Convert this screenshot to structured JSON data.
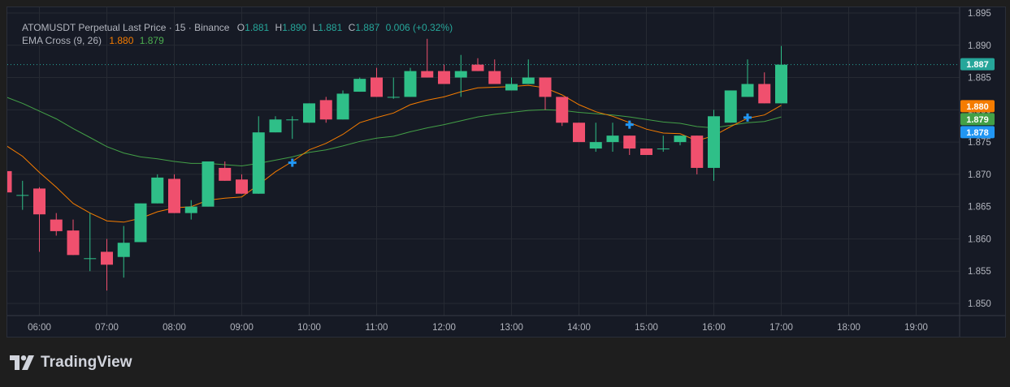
{
  "legend": {
    "symbol_line": "ATOMUSDT Perpetual Last Price · 15 · Binance",
    "o_label": "O",
    "o_value": "1.881",
    "h_label": "H",
    "h_value": "1.890",
    "l_label": "L",
    "l_value": "1.881",
    "c_label": "C",
    "c_value": "1.887",
    "change": "0.006 (+0.32%)",
    "ema_label": "EMA Cross (9, 26)",
    "ema_fast_value": "1.880",
    "ema_slow_value": "1.879"
  },
  "brand": {
    "name": "TradingView"
  },
  "colors": {
    "up": "#26a69a",
    "down": "#ef5350",
    "up_body": "#2fbf88",
    "down_body": "#f0506e",
    "ema_fast": "#f57c00",
    "ema_slow": "#43a047",
    "cross_marker": "#2196f3",
    "tag_last": "#26a69a",
    "tag_fast": "#f57c00",
    "tag_slow": "#43a047",
    "tag_cross": "#2196f3"
  },
  "chart_data": {
    "type": "candlestick",
    "timeframe": "15",
    "y_ticks": [
      "1.895",
      "1.890",
      "1.885",
      "1.880",
      "1.875",
      "1.870",
      "1.865",
      "1.860",
      "1.855",
      "1.850"
    ],
    "ylim": [
      1.8483,
      1.8968
    ],
    "x_ticks": [
      "06:00",
      "07:00",
      "08:00",
      "09:00",
      "10:00",
      "11:00",
      "12:00",
      "13:00",
      "14:00",
      "15:00",
      "16:00",
      "17:00",
      "18:00",
      "19:00"
    ],
    "x_tick_hours": [
      6,
      7,
      8,
      9,
      10,
      11,
      12,
      13,
      14,
      15,
      16,
      17,
      18,
      19
    ],
    "candles": [
      {
        "t": 5.5,
        "o": 1.8705,
        "h": 1.8719,
        "l": 1.8672,
        "c": 1.8672
      },
      {
        "t": 5.75,
        "o": 1.8668,
        "h": 1.869,
        "l": 1.8645,
        "c": 1.8668
      },
      {
        "t": 6.0,
        "o": 1.8678,
        "h": 1.868,
        "l": 1.858,
        "c": 1.8638
      },
      {
        "t": 6.25,
        "o": 1.863,
        "h": 1.864,
        "l": 1.8605,
        "c": 1.8612
      },
      {
        "t": 6.5,
        "o": 1.8613,
        "h": 1.863,
        "l": 1.8575,
        "c": 1.8575
      },
      {
        "t": 6.75,
        "o": 1.857,
        "h": 1.864,
        "l": 1.855,
        "c": 1.857
      },
      {
        "t": 7.0,
        "o": 1.858,
        "h": 1.86,
        "l": 1.852,
        "c": 1.856
      },
      {
        "t": 7.25,
        "o": 1.8572,
        "h": 1.862,
        "l": 1.854,
        "c": 1.8594
      },
      {
        "t": 7.5,
        "o": 1.8595,
        "h": 1.8655,
        "l": 1.8595,
        "c": 1.8655
      },
      {
        "t": 7.75,
        "o": 1.8655,
        "h": 1.87,
        "l": 1.8655,
        "c": 1.8695
      },
      {
        "t": 8.0,
        "o": 1.8693,
        "h": 1.87,
        "l": 1.864,
        "c": 1.864
      },
      {
        "t": 8.25,
        "o": 1.864,
        "h": 1.866,
        "l": 1.863,
        "c": 1.865
      },
      {
        "t": 8.5,
        "o": 1.865,
        "h": 1.872,
        "l": 1.865,
        "c": 1.872
      },
      {
        "t": 8.75,
        "o": 1.871,
        "h": 1.872,
        "l": 1.869,
        "c": 1.869
      },
      {
        "t": 9.0,
        "o": 1.8692,
        "h": 1.87,
        "l": 1.867,
        "c": 1.867
      },
      {
        "t": 9.25,
        "o": 1.867,
        "h": 1.879,
        "l": 1.867,
        "c": 1.8765
      },
      {
        "t": 9.5,
        "o": 1.8765,
        "h": 1.879,
        "l": 1.8765,
        "c": 1.8785
      },
      {
        "t": 9.75,
        "o": 1.8785,
        "h": 1.879,
        "l": 1.8755,
        "c": 1.8785
      },
      {
        "t": 10.0,
        "o": 1.878,
        "h": 1.881,
        "l": 1.878,
        "c": 1.881
      },
      {
        "t": 10.25,
        "o": 1.8815,
        "h": 1.882,
        "l": 1.878,
        "c": 1.8785
      },
      {
        "t": 10.5,
        "o": 1.8785,
        "h": 1.883,
        "l": 1.8785,
        "c": 1.8825
      },
      {
        "t": 10.75,
        "o": 1.8828,
        "h": 1.885,
        "l": 1.8828,
        "c": 1.8848
      },
      {
        "t": 11.0,
        "o": 1.885,
        "h": 1.8865,
        "l": 1.882,
        "c": 1.882
      },
      {
        "t": 11.25,
        "o": 1.882,
        "h": 1.885,
        "l": 1.8817,
        "c": 1.882
      },
      {
        "t": 11.5,
        "o": 1.882,
        "h": 1.8865,
        "l": 1.882,
        "c": 1.886
      },
      {
        "t": 11.75,
        "o": 1.886,
        "h": 1.891,
        "l": 1.885,
        "c": 1.885
      },
      {
        "t": 12.0,
        "o": 1.886,
        "h": 1.887,
        "l": 1.884,
        "c": 1.884
      },
      {
        "t": 12.25,
        "o": 1.885,
        "h": 1.8885,
        "l": 1.882,
        "c": 1.886
      },
      {
        "t": 12.5,
        "o": 1.887,
        "h": 1.888,
        "l": 1.886,
        "c": 1.886
      },
      {
        "t": 12.75,
        "o": 1.886,
        "h": 1.8878,
        "l": 1.884,
        "c": 1.884
      },
      {
        "t": 13.0,
        "o": 1.883,
        "h": 1.885,
        "l": 1.883,
        "c": 1.884
      },
      {
        "t": 13.25,
        "o": 1.884,
        "h": 1.8878,
        "l": 1.884,
        "c": 1.885
      },
      {
        "t": 13.5,
        "o": 1.885,
        "h": 1.885,
        "l": 1.88,
        "c": 1.882
      },
      {
        "t": 13.75,
        "o": 1.882,
        "h": 1.882,
        "l": 1.8775,
        "c": 1.878
      },
      {
        "t": 14.0,
        "o": 1.878,
        "h": 1.878,
        "l": 1.875,
        "c": 1.875
      },
      {
        "t": 14.25,
        "o": 1.874,
        "h": 1.878,
        "l": 1.8735,
        "c": 1.875
      },
      {
        "t": 14.5,
        "o": 1.875,
        "h": 1.878,
        "l": 1.8735,
        "c": 1.876
      },
      {
        "t": 14.75,
        "o": 1.876,
        "h": 1.876,
        "l": 1.873,
        "c": 1.874
      },
      {
        "t": 15.0,
        "o": 1.874,
        "h": 1.874,
        "l": 1.873,
        "c": 1.873
      },
      {
        "t": 15.25,
        "o": 1.874,
        "h": 1.876,
        "l": 1.8735,
        "c": 1.874
      },
      {
        "t": 15.5,
        "o": 1.875,
        "h": 1.876,
        "l": 1.8745,
        "c": 1.876
      },
      {
        "t": 15.75,
        "o": 1.876,
        "h": 1.876,
        "l": 1.87,
        "c": 1.871
      },
      {
        "t": 16.0,
        "o": 1.871,
        "h": 1.88,
        "l": 1.869,
        "c": 1.879
      },
      {
        "t": 16.25,
        "o": 1.878,
        "h": 1.883,
        "l": 1.878,
        "c": 1.883
      },
      {
        "t": 16.5,
        "o": 1.882,
        "h": 1.8878,
        "l": 1.882,
        "c": 1.884
      },
      {
        "t": 16.75,
        "o": 1.884,
        "h": 1.8858,
        "l": 1.881,
        "c": 1.881
      },
      {
        "t": 17.0,
        "o": 1.881,
        "h": 1.8899,
        "l": 1.881,
        "c": 1.887
      }
    ],
    "ema_fast": [
      [
        5.5,
        1.8745
      ],
      [
        5.75,
        1.8728
      ],
      [
        6.0,
        1.8703
      ],
      [
        6.25,
        1.868
      ],
      [
        6.5,
        1.8655
      ],
      [
        6.75,
        1.864
      ],
      [
        7.0,
        1.8628
      ],
      [
        7.25,
        1.8626
      ],
      [
        7.5,
        1.8632
      ],
      [
        7.75,
        1.8642
      ],
      [
        8.0,
        1.8648
      ],
      [
        8.25,
        1.865
      ],
      [
        8.5,
        1.866
      ],
      [
        8.75,
        1.8663
      ],
      [
        9.0,
        1.8665
      ],
      [
        9.25,
        1.8684
      ],
      [
        9.5,
        1.8704
      ],
      [
        9.75,
        1.872
      ],
      [
        10.0,
        1.8738
      ],
      [
        10.25,
        1.8748
      ],
      [
        10.5,
        1.8762
      ],
      [
        10.75,
        1.878
      ],
      [
        11.0,
        1.8788
      ],
      [
        11.25,
        1.8795
      ],
      [
        11.5,
        1.8808
      ],
      [
        11.75,
        1.8815
      ],
      [
        12.0,
        1.882
      ],
      [
        12.25,
        1.8828
      ],
      [
        12.5,
        1.8834
      ],
      [
        12.75,
        1.8835
      ],
      [
        13.0,
        1.8836
      ],
      [
        13.25,
        1.8838
      ],
      [
        13.5,
        1.8834
      ],
      [
        13.75,
        1.8823
      ],
      [
        14.0,
        1.8808
      ],
      [
        14.25,
        1.8797
      ],
      [
        14.5,
        1.879
      ],
      [
        14.75,
        1.878
      ],
      [
        15.0,
        1.877
      ],
      [
        15.25,
        1.8764
      ],
      [
        15.5,
        1.8763
      ],
      [
        15.75,
        1.8752
      ],
      [
        16.0,
        1.876
      ],
      [
        16.25,
        1.8774
      ],
      [
        16.5,
        1.8787
      ],
      [
        16.75,
        1.8792
      ],
      [
        17.0,
        1.8807
      ]
    ],
    "ema_slow": [
      [
        5.5,
        1.882
      ],
      [
        5.75,
        1.881
      ],
      [
        6.0,
        1.8798
      ],
      [
        6.25,
        1.8786
      ],
      [
        6.5,
        1.8771
      ],
      [
        6.75,
        1.8757
      ],
      [
        7.0,
        1.8743
      ],
      [
        7.25,
        1.8733
      ],
      [
        7.5,
        1.8727
      ],
      [
        7.75,
        1.8724
      ],
      [
        8.0,
        1.872
      ],
      [
        8.25,
        1.8717
      ],
      [
        8.5,
        1.8717
      ],
      [
        8.75,
        1.8715
      ],
      [
        9.0,
        1.8713
      ],
      [
        9.25,
        1.8717
      ],
      [
        9.5,
        1.8722
      ],
      [
        9.75,
        1.8727
      ],
      [
        10.0,
        1.8734
      ],
      [
        10.25,
        1.8738
      ],
      [
        10.5,
        1.8744
      ],
      [
        10.75,
        1.8751
      ],
      [
        11.0,
        1.8756
      ],
      [
        11.25,
        1.8759
      ],
      [
        11.5,
        1.8766
      ],
      [
        11.75,
        1.8772
      ],
      [
        12.0,
        1.8777
      ],
      [
        12.25,
        1.8783
      ],
      [
        12.5,
        1.8789
      ],
      [
        12.75,
        1.8793
      ],
      [
        13.0,
        1.8796
      ],
      [
        13.25,
        1.8799
      ],
      [
        13.5,
        1.88
      ],
      [
        13.75,
        1.8799
      ],
      [
        14.0,
        1.8796
      ],
      [
        14.25,
        1.8794
      ],
      [
        14.5,
        1.8792
      ],
      [
        14.75,
        1.8789
      ],
      [
        15.0,
        1.8785
      ],
      [
        15.25,
        1.8781
      ],
      [
        15.5,
        1.8779
      ],
      [
        15.75,
        1.8774
      ],
      [
        16.0,
        1.8772
      ],
      [
        16.25,
        1.8776
      ],
      [
        16.5,
        1.878
      ],
      [
        16.75,
        1.8782
      ],
      [
        17.0,
        1.8789
      ]
    ],
    "cross_markers": [
      [
        9.75,
        1.8718
      ],
      [
        14.75,
        1.8777
      ],
      [
        16.5,
        1.8788
      ]
    ],
    "last_price": 1.887,
    "price_tags": [
      {
        "label": "1.887",
        "value": 1.887,
        "color_key": "tag_last"
      },
      {
        "label": "1.880",
        "value": 1.8805,
        "color_key": "tag_fast"
      },
      {
        "label": "1.879",
        "value": 1.8788,
        "color_key": "tag_slow"
      },
      {
        "label": "1.878",
        "value": 1.8772,
        "color_key": "tag_cross"
      }
    ]
  }
}
